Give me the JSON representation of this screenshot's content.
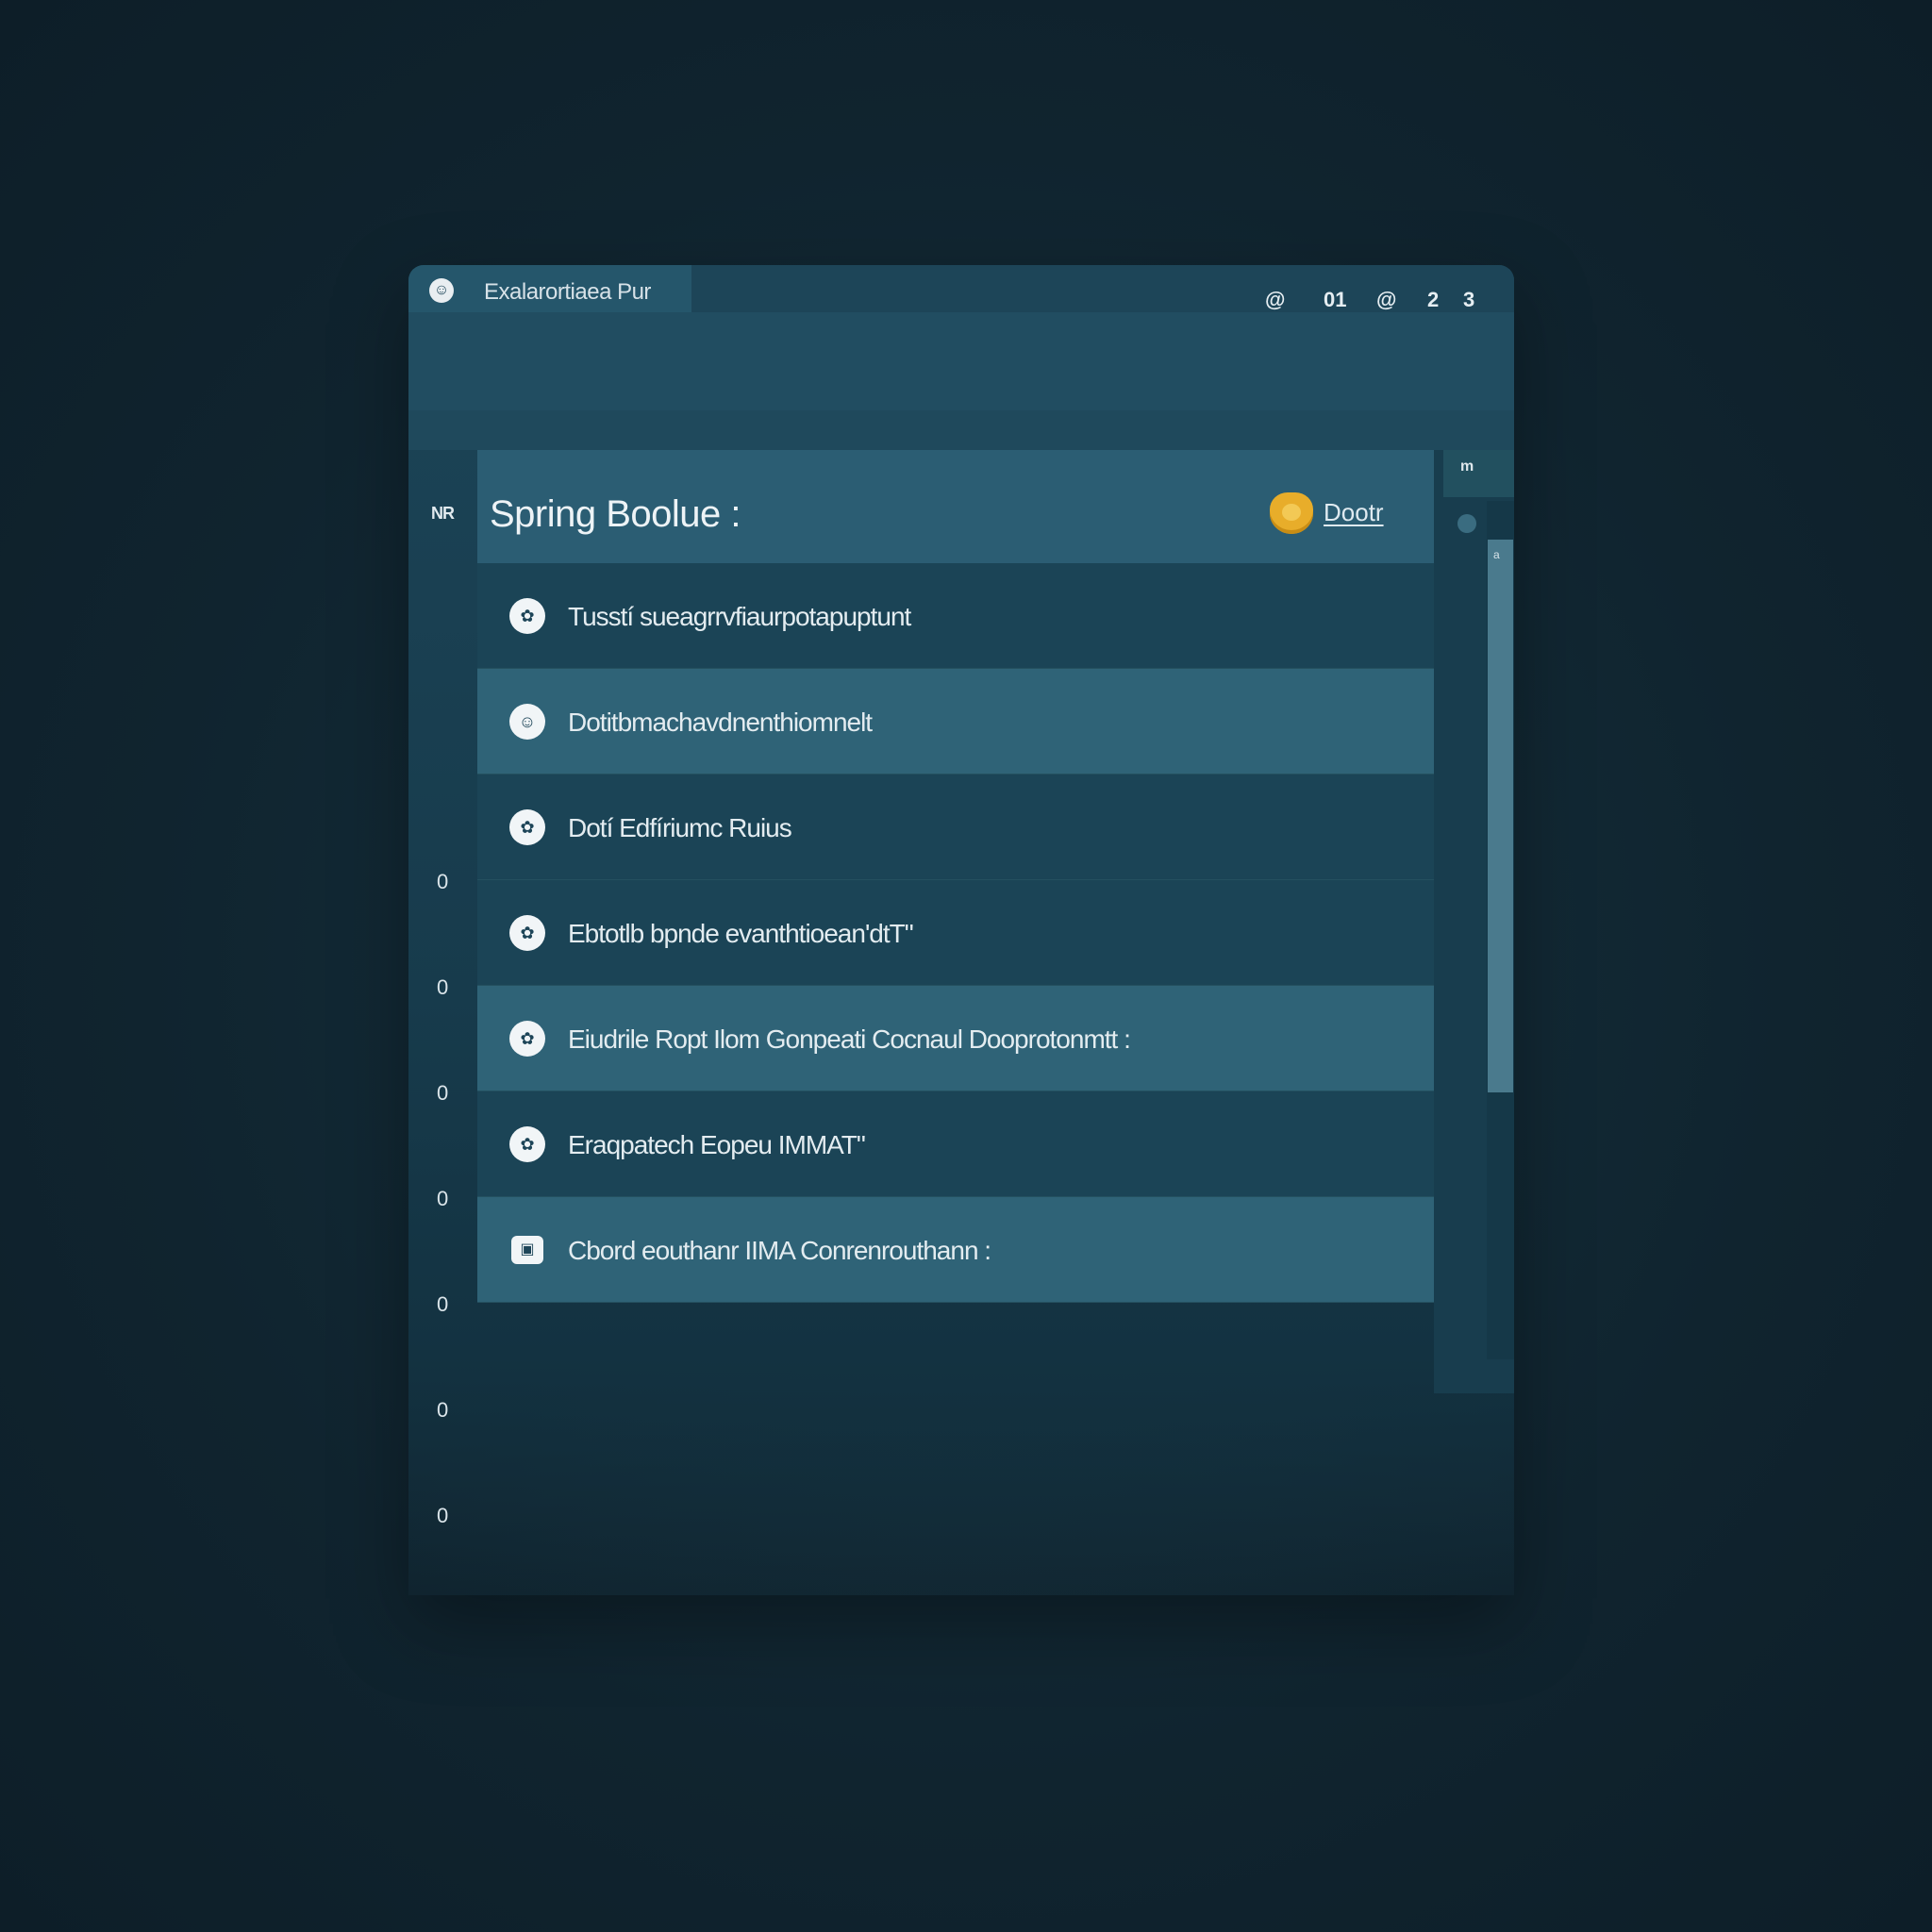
{
  "window": {
    "tab_title": "Exalarortiaea Pur",
    "tab_icon": "app-logo-icon"
  },
  "toolbar": {
    "items": [
      "@",
      "01",
      "@",
      "2",
      "3"
    ]
  },
  "panel": {
    "gutter_label": "NR",
    "title": "Spring Boolue :",
    "badge_link": "Dootr",
    "badge_icon": "shield-badge-icon",
    "badge_color": "#e8ad2a"
  },
  "rail": {
    "top_label": "m",
    "thumb_label": "a"
  },
  "list": {
    "rows": [
      {
        "num": "0",
        "label": "Tusstí sueagrrvfiaurpotapuptunt",
        "icon": "gear-icon"
      },
      {
        "num": "0",
        "label": "Dotitbmachavdnenthiomnelt",
        "icon": "smile-icon"
      },
      {
        "num": "0",
        "label": "Dotí Edfíriumc Ruius",
        "icon": "gear-icon"
      },
      {
        "num": "0",
        "label": "Ebtotlb bpnde evanthtioean'dtT\"",
        "icon": "gear-icon"
      },
      {
        "num": "0",
        "label": "Eiudrile Ropt Ilom Gonpeati Cocnaul Dooprotonmtt :",
        "icon": "gear-icon"
      },
      {
        "num": "0",
        "label": "Eraqpatech Eopeu IMMAT\"",
        "icon": "gear-icon"
      },
      {
        "num": "0",
        "label": "Cbord eouthanr IIMA Conrenrouthann :",
        "icon": "image-icon"
      }
    ]
  }
}
